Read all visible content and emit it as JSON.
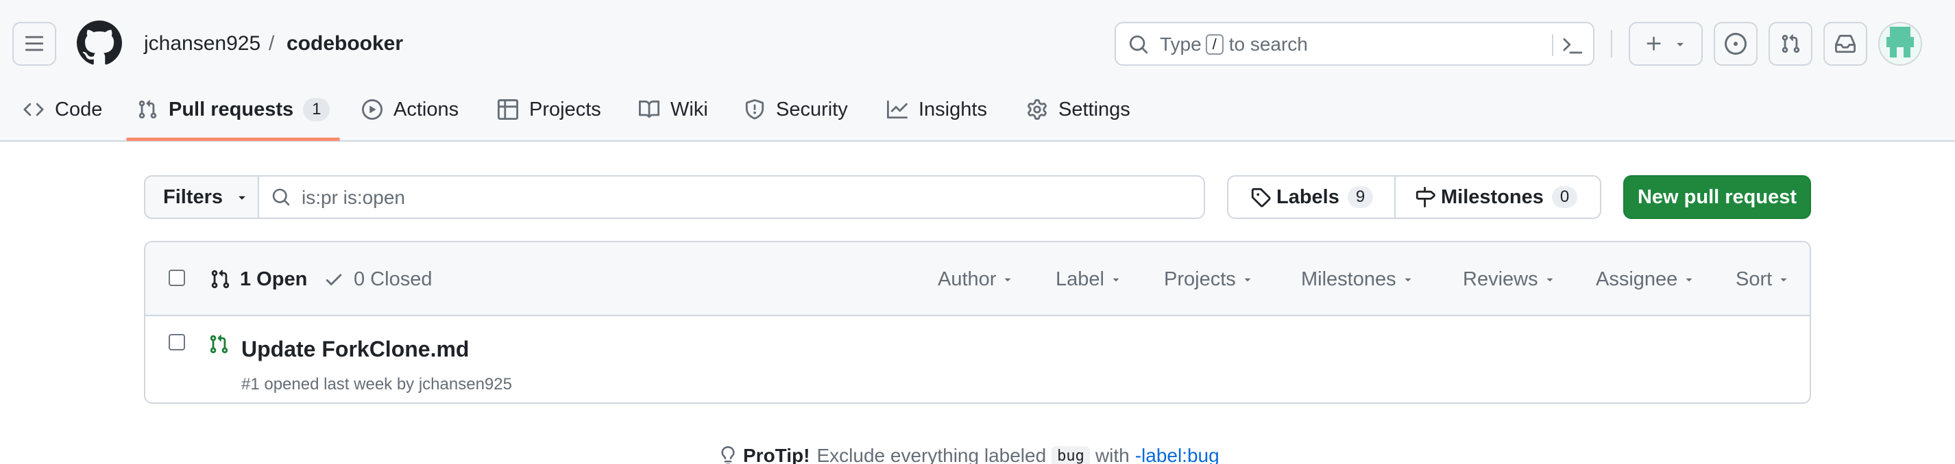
{
  "header": {
    "owner": "jchansen925",
    "separator": "/",
    "repo": "codebooker",
    "search": {
      "prefix": "Type",
      "key": "/",
      "suffix": "to search"
    },
    "icons": [
      "hamburger-menu-icon",
      "github-logo-icon",
      "search-icon",
      "command-palette-icon",
      "plus-icon",
      "issues-icon",
      "pull-requests-icon",
      "inbox-icon"
    ]
  },
  "tabs": [
    {
      "label": "Code",
      "icon": "code-icon"
    },
    {
      "label": "Pull requests",
      "icon": "git-pull-request-icon",
      "counter": "1"
    },
    {
      "label": "Actions",
      "icon": "play-icon"
    },
    {
      "label": "Projects",
      "icon": "table-icon"
    },
    {
      "label": "Wiki",
      "icon": "book-icon"
    },
    {
      "label": "Security",
      "icon": "shield-icon"
    },
    {
      "label": "Insights",
      "icon": "graph-icon"
    },
    {
      "label": "Settings",
      "icon": "gear-icon"
    }
  ],
  "toolbar": {
    "filters_label": "Filters",
    "query": "is:pr is:open",
    "labels_label": "Labels",
    "labels_count": "9",
    "milestones_label": "Milestones",
    "milestones_count": "0",
    "new_pr_label": "New pull request"
  },
  "list": {
    "open_label": "1 Open",
    "closed_label": "0 Closed",
    "filters": [
      "Author",
      "Label",
      "Projects",
      "Milestones",
      "Reviews",
      "Assignee",
      "Sort"
    ],
    "items": [
      {
        "title": "Update ForkClone.md",
        "meta": "#1 opened last week by jchansen925"
      }
    ]
  },
  "protip": {
    "strong": "ProTip!",
    "text": "Exclude everything labeled",
    "code": "bug",
    "with": "with",
    "link": "-label:bug"
  },
  "colors": {
    "accent_underline": "#fd8c73",
    "primary_button": "#1f883d",
    "open_icon": "#1a7f37",
    "link": "#0969da"
  }
}
